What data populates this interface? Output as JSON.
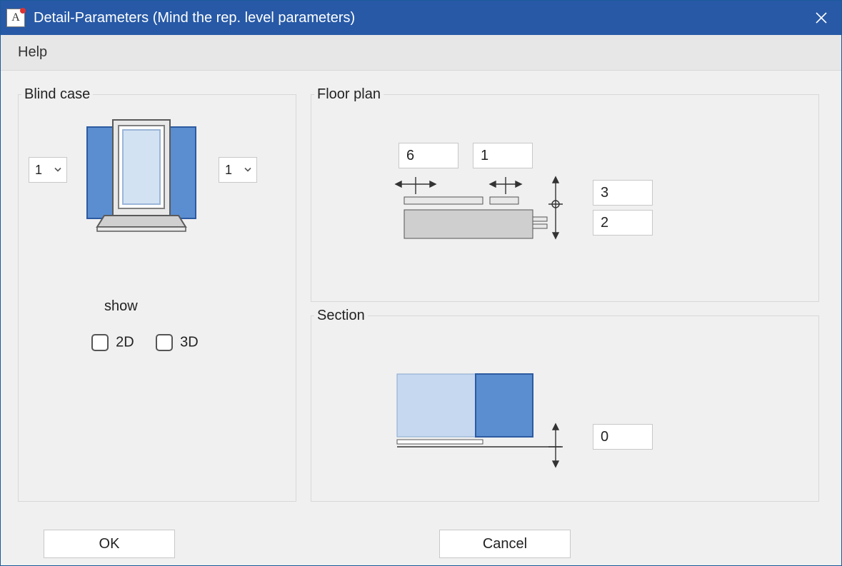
{
  "window": {
    "title": "Detail-Parameters (Mind the rep. level parameters)"
  },
  "menu": {
    "help": "Help"
  },
  "groups": {
    "blind_case": "Blind case",
    "floor_plan": "Floor plan",
    "section": "Section"
  },
  "blind": {
    "left_select": "1",
    "right_select": "1",
    "show_label": "show",
    "cb_2d_label": "2D",
    "cb_3d_label": "3D",
    "cb_2d_checked": false,
    "cb_3d_checked": false
  },
  "floor_plan": {
    "val_a": "6",
    "val_b": "1",
    "val_c": "3",
    "val_d": "2"
  },
  "section": {
    "val": "0"
  },
  "buttons": {
    "ok": "OK",
    "cancel": "Cancel"
  },
  "colors": {
    "titlebar": "#2759a6",
    "shutter_blue": "#5b8ed1",
    "shutter_light": "#c5d8ef",
    "glass": "#d3e2f3",
    "frame_grey": "#bfbfbf",
    "frame_dark": "#5a5a5a"
  }
}
